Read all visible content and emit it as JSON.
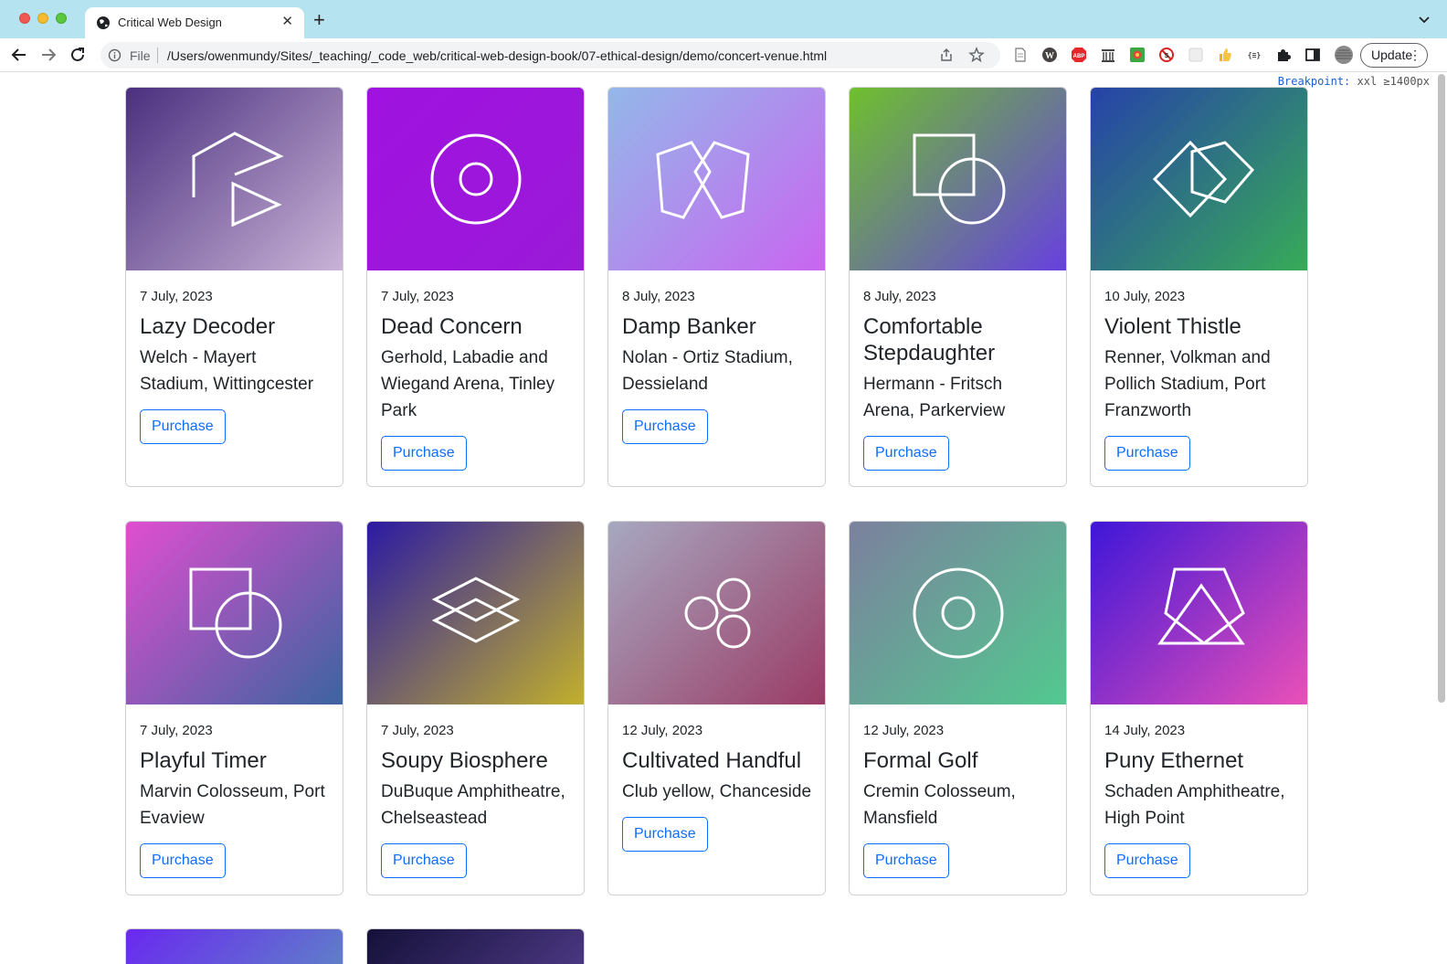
{
  "browser": {
    "tab_title": "Critical Web Design",
    "new_tab": "+",
    "url_scheme": "File",
    "url": "/Users/owenmundy/Sites/_teaching/_code_web/critical-web-design-book/07-ethical-design/demo/concert-venue.html",
    "update_label": "Update",
    "extensions": [
      "document-icon",
      "wordpress-icon",
      "adblock-icon",
      "archive-icon",
      "color-picker-icon",
      "no-script-icon",
      "blank-ext-icon",
      "thumbs-up-icon",
      "json-viewer-icon",
      "puzzle-icon",
      "side-panel-icon",
      "profile-avatar"
    ]
  },
  "breakpoint": {
    "label": "Breakpoint:",
    "value": "xxl ≥1400px"
  },
  "purchase_label": "Purchase",
  "cards": [
    {
      "date": "7 July, 2023",
      "title": "Lazy Decoder",
      "venue": "Welch - Mayert Stadium, Wittingcester",
      "icon": "polygon-play-icon",
      "gradient": [
        "#4a2f7f",
        "#c9b3d6"
      ]
    },
    {
      "date": "7 July, 2023",
      "title": "Dead Concern",
      "venue": "Gerhold, Labadie and Wiegand Arena, Tinley Park",
      "icon": "target-circle-icon",
      "gradient": [
        "#a012e0",
        "#9a1ad8"
      ]
    },
    {
      "date": "8 July, 2023",
      "title": "Damp Banker",
      "venue": "Nolan - Ortiz Stadium, Dessieland",
      "icon": "two-pentagons-icon",
      "gradient": [
        "#93b8ea",
        "#c965f0"
      ]
    },
    {
      "date": "8 July, 2023",
      "title": "Comfortable Stepdaughter",
      "venue": "Hermann - Fritsch Arena, Parkerview",
      "icon": "square-circle-icon",
      "gradient": [
        "#6ec02e",
        "#6740e0"
      ]
    },
    {
      "date": "10 July, 2023",
      "title": "Violent Thistle",
      "venue": "Renner, Volkman and Pollich Stadium, Port Franzworth",
      "icon": "diamonds-icon",
      "gradient": [
        "#2642a8",
        "#37ab58"
      ]
    },
    {
      "date": "7 July, 2023",
      "title": "Playful Timer",
      "venue": "Marvin Colosseum, Port Evaview",
      "icon": "square-circle-icon",
      "gradient": [
        "#e04ed0",
        "#3c64a0"
      ]
    },
    {
      "date": "7 July, 2023",
      "title": "Soupy Biosphere",
      "venue": "DuBuque Amphitheatre, Chelseastead",
      "icon": "layers-icon",
      "gradient": [
        "#2b1aa2",
        "#c2b02c"
      ]
    },
    {
      "date": "12 July, 2023",
      "title": "Cultivated Handful",
      "venue": "Club yellow, Chanceside",
      "icon": "three-circles-icon",
      "gradient": [
        "#a7a8c1",
        "#9a3c66"
      ]
    },
    {
      "date": "12 July, 2023",
      "title": "Formal Golf",
      "venue": "Cremin Colosseum, Mansfield",
      "icon": "target-circle-icon",
      "gradient": [
        "#7c809e",
        "#52c98f"
      ]
    },
    {
      "date": "14 July, 2023",
      "title": "Puny Ethernet",
      "venue": "Schaden Amphitheatre, High Point",
      "icon": "triangles-icon",
      "gradient": [
        "#3e16d8",
        "#ea50b8"
      ]
    }
  ],
  "partial_cards": [
    {
      "gradient": [
        "#6a28f0",
        "#5e85c6"
      ]
    },
    {
      "gradient": [
        "#15113a",
        "#4e3a86"
      ]
    }
  ]
}
